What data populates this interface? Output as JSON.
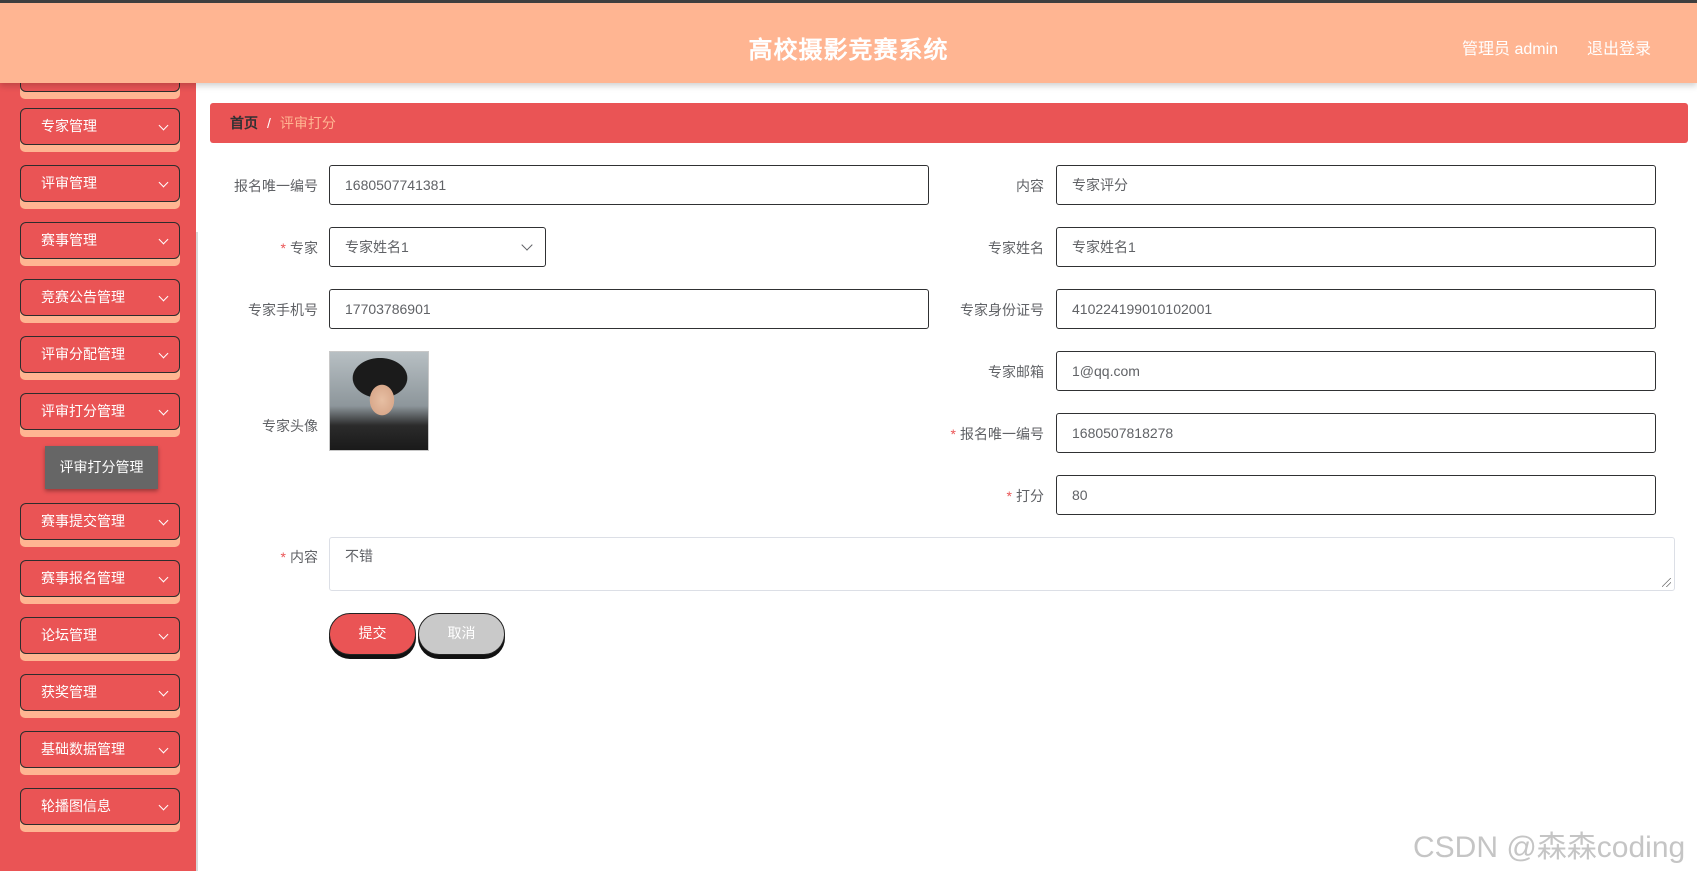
{
  "header": {
    "title": "高校摄影竞赛系统",
    "user_label": "管理员 admin",
    "logout": "退出登录"
  },
  "sidebar": {
    "items": [
      {
        "label": "专家管理"
      },
      {
        "label": "评审管理"
      },
      {
        "label": "赛事管理"
      },
      {
        "label": "竞赛公告管理"
      },
      {
        "label": "评审分配管理"
      },
      {
        "label": "评审打分管理"
      },
      {
        "label": "赛事提交管理"
      },
      {
        "label": "赛事报名管理"
      },
      {
        "label": "论坛管理"
      },
      {
        "label": "获奖管理"
      },
      {
        "label": "基础数据管理"
      },
      {
        "label": "轮播图信息"
      }
    ],
    "active_submenu": "评审打分管理"
  },
  "breadcrumb": {
    "home": "首页",
    "separator": "/",
    "current": "评审打分"
  },
  "form": {
    "signup_no_label": "报名唯一编号",
    "signup_no_value": "1680507741381",
    "content_top_label": "内容",
    "content_top_value": "专家评分",
    "expert_label": "专家",
    "expert_value": "专家姓名1",
    "expert_name_label": "专家姓名",
    "expert_name_value": "专家姓名1",
    "expert_phone_label": "专家手机号",
    "expert_phone_value": "17703786901",
    "expert_id_label": "专家身份证号",
    "expert_id_value": "410224199010102001",
    "expert_email_label": "专家邮箱",
    "expert_email_value": "1@qq.com",
    "avatar_label": "专家头像",
    "signup_no2_label": "报名唯一编号",
    "signup_no2_value": "1680507818278",
    "score_label": "打分",
    "score_value": "80",
    "content_label": "内容",
    "content_value": "不错",
    "submit": "提交",
    "cancel": "取消",
    "required_mark": "*"
  },
  "watermark": "CSDN @森森coding",
  "colors": {
    "header_bg": "#ffb592",
    "sidebar_bg": "#ea5455",
    "accent": "#ea5455"
  }
}
